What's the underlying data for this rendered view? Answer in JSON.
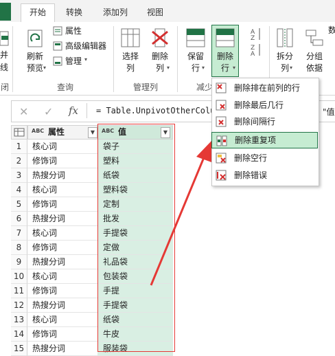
{
  "tabs": [
    "开始",
    "转换",
    "添加列",
    "视图"
  ],
  "ribbon": {
    "partial_left": [
      "并",
      "线"
    ],
    "refresh": {
      "line1": "刷新",
      "line2": "预览"
    },
    "query_small": [
      "属性",
      "高级编辑器",
      "管理"
    ],
    "select_cols": {
      "line1": "选择",
      "line2": "列"
    },
    "remove_cols": {
      "line1": "删除",
      "line2": "列"
    },
    "keep_rows": {
      "line1": "保留",
      "line2": "行"
    },
    "remove_rows": {
      "line1": "删除",
      "line2": "行"
    },
    "split_col": {
      "line1": "拆分",
      "line2": "列"
    },
    "group_by": {
      "line1": "分组",
      "line2": "依据"
    },
    "partial_right": "数",
    "groups": {
      "close": "闭",
      "query": "查询",
      "manage_cols": "管理列",
      "reduce_rows": "减少"
    }
  },
  "formula": {
    "text": "= Table.UnpivotOtherColumns",
    "tail": "\"值"
  },
  "grid": {
    "col1_type": "ABC",
    "col1_header": "属性",
    "col2_type": "ABC",
    "col2_header": "值",
    "rows": [
      {
        "n": "1",
        "attr": "核心词",
        "val": "袋子"
      },
      {
        "n": "2",
        "attr": "修饰词",
        "val": "塑料"
      },
      {
        "n": "3",
        "attr": "热搜分词",
        "val": "纸袋"
      },
      {
        "n": "4",
        "attr": "核心词",
        "val": "塑料袋"
      },
      {
        "n": "5",
        "attr": "修饰词",
        "val": "定制"
      },
      {
        "n": "6",
        "attr": "热搜分词",
        "val": "批发"
      },
      {
        "n": "7",
        "attr": "核心词",
        "val": "手提袋"
      },
      {
        "n": "8",
        "attr": "修饰词",
        "val": "定做"
      },
      {
        "n": "9",
        "attr": "热搜分词",
        "val": "礼品袋"
      },
      {
        "n": "10",
        "attr": "核心词",
        "val": "包装袋"
      },
      {
        "n": "11",
        "attr": "修饰词",
        "val": "手提"
      },
      {
        "n": "12",
        "attr": "热搜分词",
        "val": "手提袋"
      },
      {
        "n": "13",
        "attr": "核心词",
        "val": "纸袋"
      },
      {
        "n": "14",
        "attr": "修饰词",
        "val": "牛皮"
      },
      {
        "n": "15",
        "attr": "热搜分词",
        "val": "服装袋"
      }
    ]
  },
  "menu": {
    "items": [
      "删除排在前列的行",
      "删除最后几行",
      "删除间隔行",
      "删除重复项",
      "删除空行",
      "删除错误"
    ],
    "highlighted": "删除重复项"
  },
  "colors": {
    "accent": "#217346",
    "value_fill": "#d9efe3",
    "annotation": "#e53935"
  }
}
